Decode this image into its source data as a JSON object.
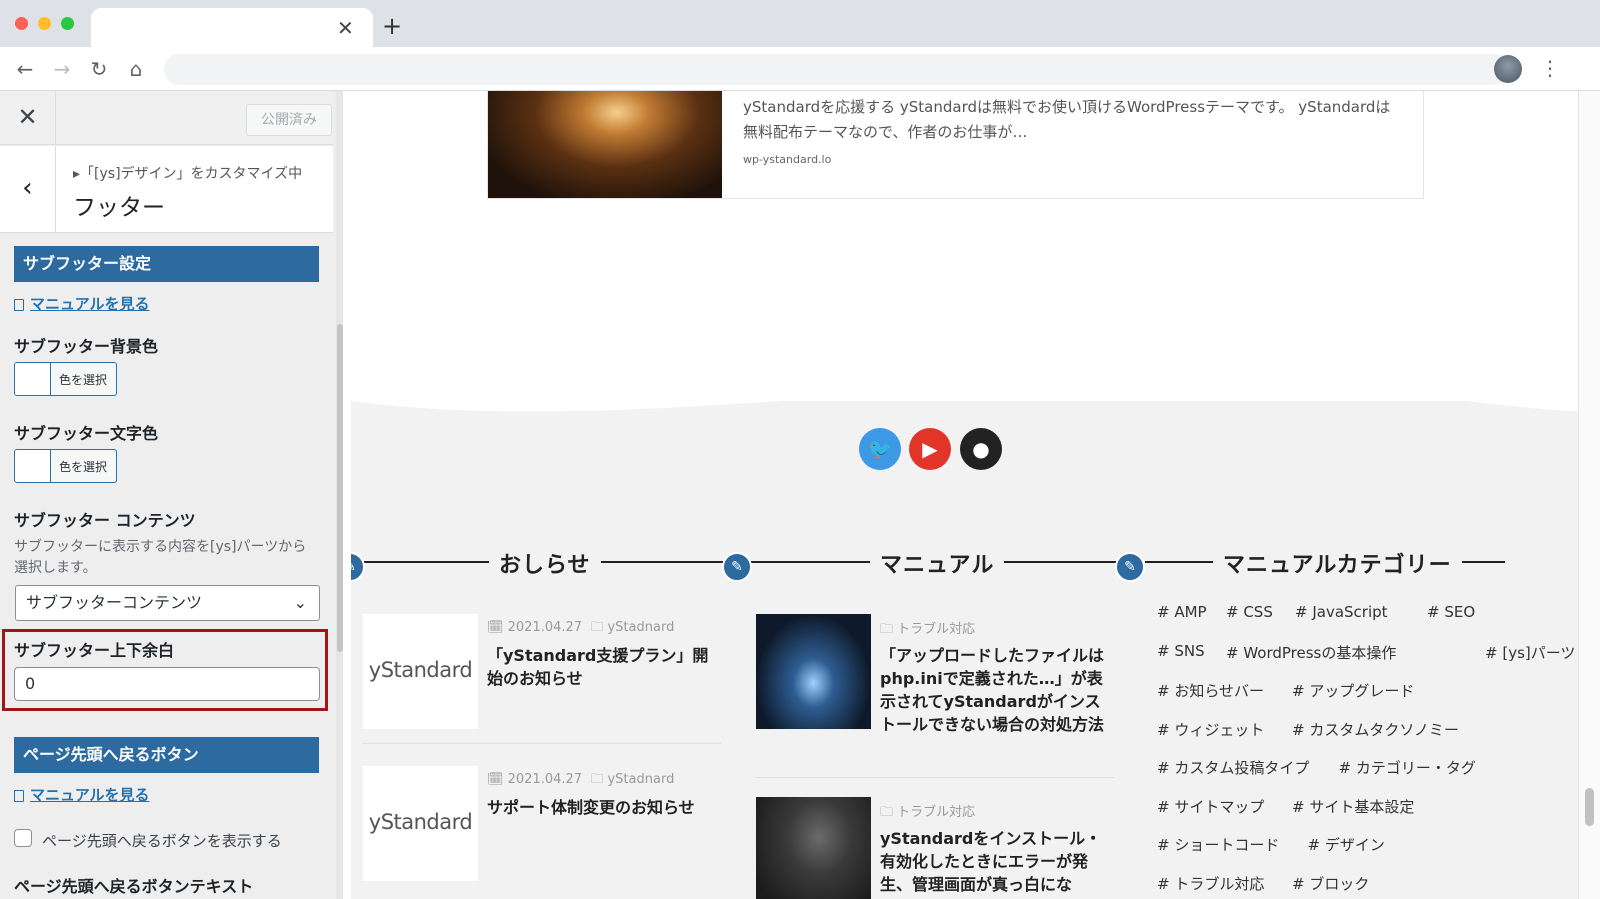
{
  "panel": {
    "published_label": "公開済み",
    "breadcrumb": "▸「[ys]デザイン」をカスタマイズ中",
    "heading": "フッター",
    "sections": [
      {
        "title": "サブフッター設定",
        "manual": "マニュアルを見る"
      },
      {
        "title": "ページ先頭へ戻るボタン",
        "manual": "マニュアルを見る"
      }
    ],
    "bg_color_label": "サブフッター背景色",
    "text_color_label": "サブフッター文字色",
    "color_button_label": "色を選択",
    "content_label": "サブフッター コンテンツ",
    "content_desc": "サブフッターに表示する内容を[ys]パーツから選択します。",
    "content_select_value": "サブフッターコンテンツ",
    "padding_label": "サブフッター上下余白",
    "padding_value": "0",
    "back_to_top_checkbox": "ページ先頭へ戻るボタンを表示する",
    "cut_label": "ページ先頭へ戻るボタンテキスト"
  },
  "preview": {
    "card_excerpt": "yStandardを応援する yStandardは無料でお使い頂けるWordPressテーマです。 yStandardは無料配布テーマなので、作者のお仕事が…",
    "card_url": "wp-ystandard.lo",
    "social": [
      "twitter-icon",
      "youtube-icon",
      "github-icon"
    ],
    "widgets": {
      "news": {
        "title": "おしらせ",
        "posts": [
          {
            "date": "2021.04.27",
            "author": "yStadnard",
            "title": "「yStandard支援プラン」開始のお知らせ",
            "thumb": "yStandard"
          },
          {
            "date": "2021.04.27",
            "author": "yStadnard",
            "title": "サポート体制変更のお知らせ",
            "thumb": "yStandard"
          }
        ]
      },
      "manual": {
        "title": "マニュアル",
        "posts": [
          {
            "category": "トラブル対応",
            "title": "「アップロードしたファイルはphp.iniで定義された…」が表示されてyStandardがインストールできない場合の対処方法"
          },
          {
            "category": "トラブル対応",
            "title": "yStandardをインストール・有効化したときにエラーが発生、管理画面が真っ白にな"
          }
        ]
      },
      "categories": {
        "title": "マニュアルカテゴリー",
        "tags": [
          "AMP",
          "CSS",
          "JavaScript",
          "SEO",
          "SNS",
          "WordPressの基本操作",
          "[ys]パーツ",
          "お知らせバー",
          "アップグレード",
          "ウィジェット",
          "カスタムタクソノミー",
          "カスタム投稿タイプ",
          "カテゴリー・タグ",
          "サイトマップ",
          "サイト基本設定",
          "ショートコード",
          "デザイン",
          "トラブル対応",
          "ブロック"
        ]
      }
    }
  },
  "colors": {
    "accent": "#2c6aa0",
    "highlight": "#a0171a",
    "twitter": "#3d98e6",
    "youtube": "#e1352a",
    "github": "#222222"
  }
}
